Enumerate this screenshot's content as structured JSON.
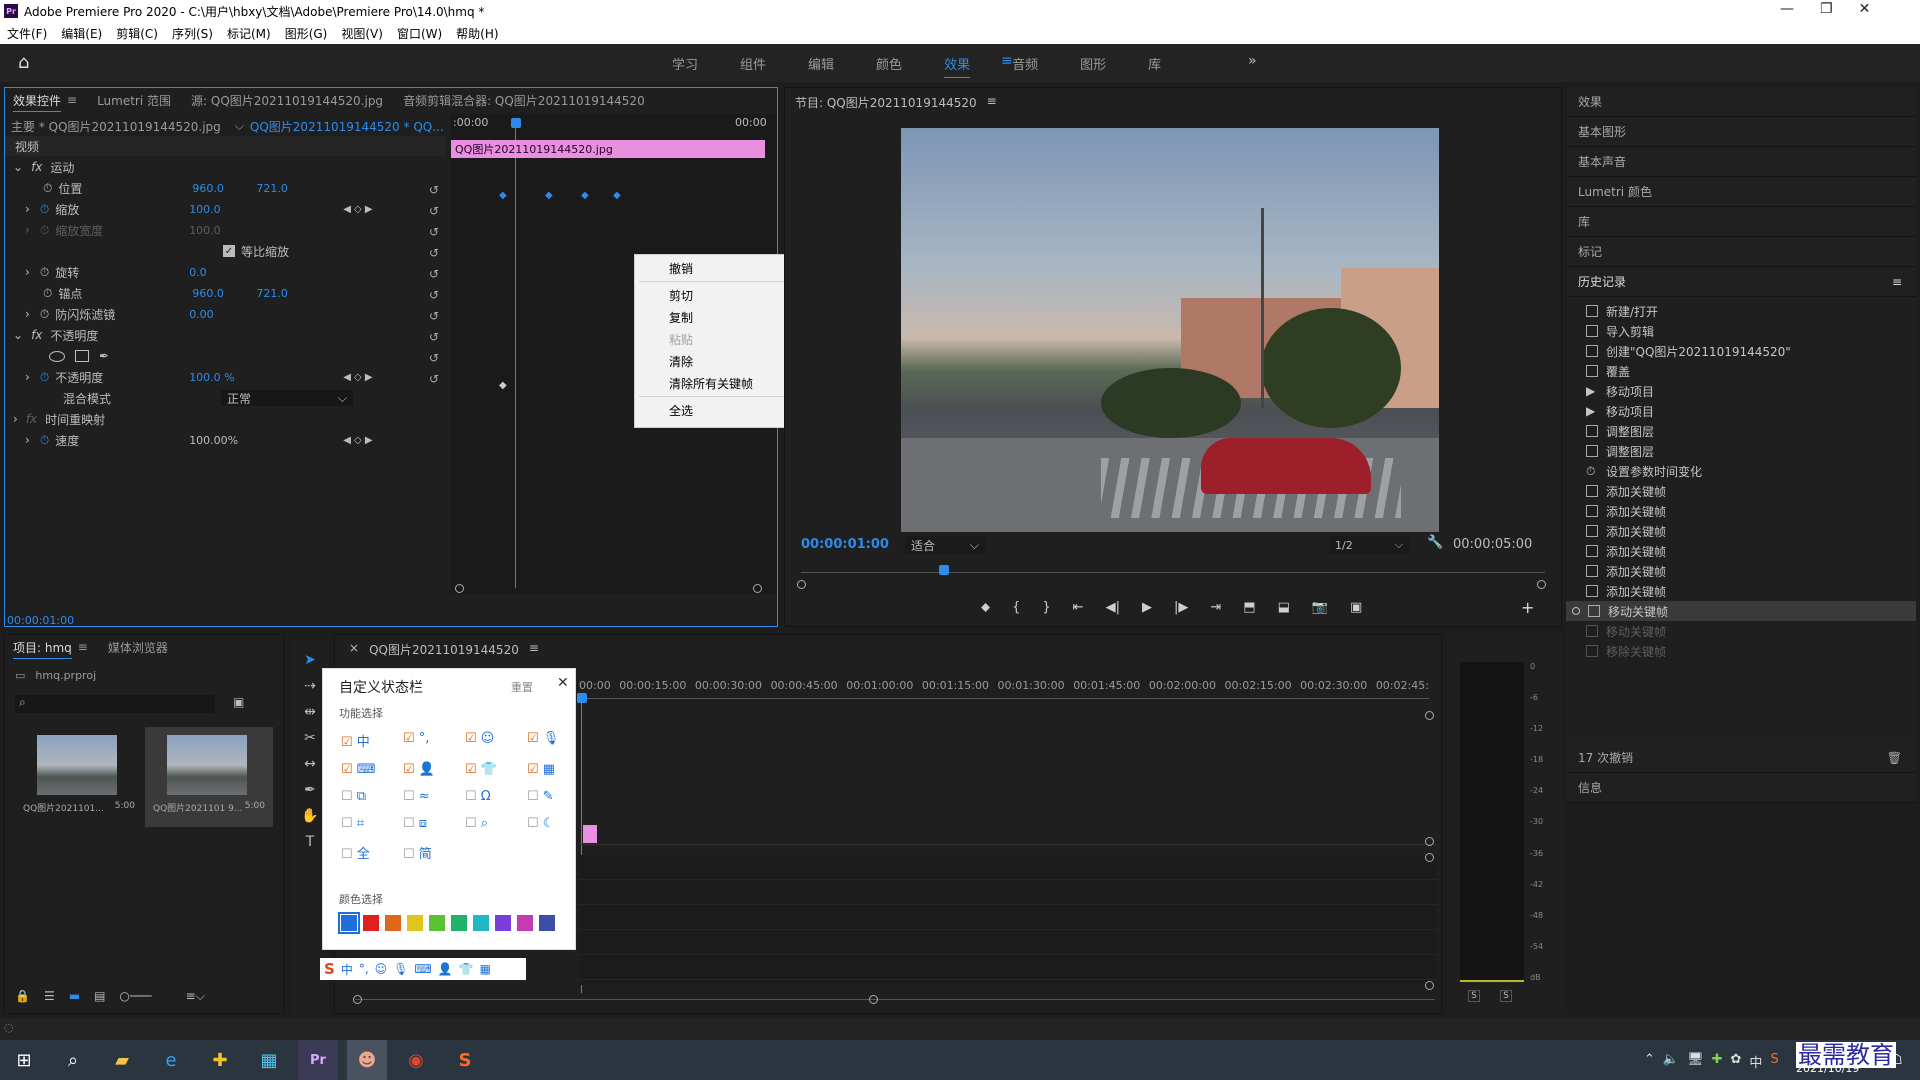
{
  "app": {
    "logo": "Pr",
    "title": "Adobe Premiere Pro 2020 - C:\\用户\\hbxy\\文档\\Adobe\\Premiere Pro\\14.0\\hmq *"
  },
  "menu": [
    "文件(F)",
    "编辑(E)",
    "剪辑(C)",
    "序列(S)",
    "标记(M)",
    "图形(G)",
    "视图(V)",
    "窗口(W)",
    "帮助(H)"
  ],
  "workspaces": [
    "学习",
    "组件",
    "编辑",
    "颜色",
    "效果",
    "音频",
    "图形",
    "库"
  ],
  "workspace_active": "效果",
  "effect_controls": {
    "tabs": [
      "效果控件",
      "Lumetri 范围",
      "源: QQ图片20211019144520.jpg",
      "音频剪辑混合器: QQ图片20211019144520"
    ],
    "master": "主要 * QQ图片20211019144520.jpg",
    "sequence": "QQ图片20211019144520 * QQ...",
    "time_start": ":00:00",
    "time_end": "00:00",
    "clip_label": "QQ图片20211019144520.jpg",
    "section_video": "视频",
    "motion": "运动",
    "position_label": "位置",
    "position_x": "960.0",
    "position_y": "721.0",
    "scale_label": "缩放",
    "scale_value": "100.0",
    "scale_width_label": "缩放宽度",
    "scale_width_value": "100.0",
    "uniform_label": "等比缩放",
    "rotation_label": "旋转",
    "rotation_value": "0.0",
    "anchor_label": "锚点",
    "anchor_x": "960.0",
    "anchor_y": "721.0",
    "flicker_label": "防闪烁滤镜",
    "flicker_value": "0.00",
    "opacity_section": "不透明度",
    "opacity_label": "不透明度",
    "opacity_value": "100.0 %",
    "blend_label": "混合模式",
    "blend_value": "正常",
    "time_remap": "时间重映射",
    "speed_label": "速度",
    "speed_value": "100.00%",
    "current_time": "00:00:01:00"
  },
  "context_menu": [
    "撤销",
    "剪切",
    "复制",
    "粘贴",
    "清除",
    "清除所有关键帧",
    "全选"
  ],
  "program": {
    "title": "节目: QQ图片20211019144520",
    "timecode": "00:00:01:00",
    "fit": "适合",
    "resolution": "1/2",
    "duration": "00:00:05:00"
  },
  "right_panels": [
    "效果",
    "基本图形",
    "基本声音",
    "Lumetri 颜色",
    "库",
    "标记"
  ],
  "history": {
    "title": "历史记录",
    "items": [
      "新建/打开",
      "导入剪辑",
      "创建\"QQ图片20211019144520\"",
      "覆盖",
      "移动项目",
      "移动项目",
      "调整图层",
      "调整图层",
      "设置参数时间变化",
      "添加关键帧",
      "添加关键帧",
      "添加关键帧",
      "添加关键帧",
      "添加关键帧",
      "添加关键帧",
      "移动关键帧",
      "移动关键帧",
      "移除关键帧"
    ],
    "undo_count": "17 次撤销",
    "info": "信息"
  },
  "project": {
    "tabs": [
      "项目: hmq",
      "媒体浏览器"
    ],
    "file": "hmq.prproj",
    "items": [
      {
        "name": "QQ图片2021101...",
        "dur": "5:00"
      },
      {
        "name": "QQ图片2021101 9...",
        "dur": "5:00"
      }
    ]
  },
  "timeline": {
    "title": "QQ图片20211019144520",
    "ticks": [
      "00:00",
      "00:00:15:00",
      "00:00:30:00",
      "00:00:45:00",
      "00:01:00:00",
      "00:01:15:00",
      "00:01:30:00",
      "00:01:45:00",
      "00:02:00:00",
      "00:02:15:00",
      "00:02:30:00",
      "00:02:45:"
    ]
  },
  "meter_scale": [
    "0",
    "-6",
    "-12",
    "-18",
    "-24",
    "-30",
    "-36",
    "-42",
    "-48",
    "-54",
    "dB"
  ],
  "meter_solo": [
    "S",
    "S"
  ],
  "custom_statusbar": {
    "title": "自定义状态栏",
    "reset": "重置",
    "func_label": "功能选择",
    "color_label": "颜色选择",
    "text_items": [
      "中",
      "全",
      "简"
    ],
    "swatches": [
      "#1e6fd9",
      "#e02020",
      "#e0661a",
      "#e0c419",
      "#5ac332",
      "#1fb36a",
      "#1fb8c4",
      "#7a3ed8",
      "#c43db0",
      "#3c4fa8"
    ]
  },
  "taskbar": {
    "date": "2021/10/19",
    "watermark": "最需教育"
  }
}
